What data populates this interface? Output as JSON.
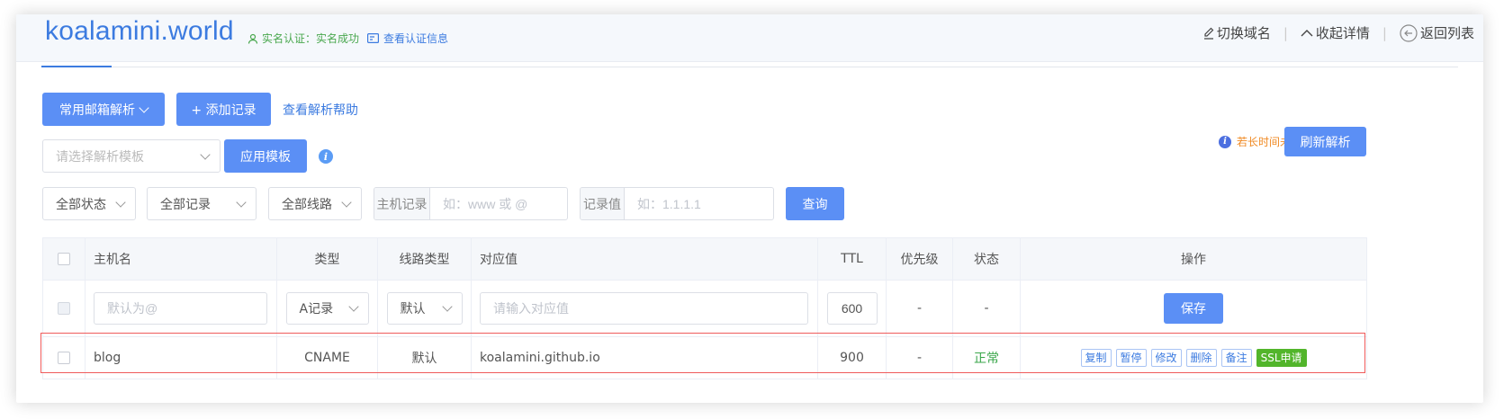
{
  "header": {
    "domain": "koalamini.world",
    "verify_text": "实名认证：实名成功",
    "view_verify": "查看认证信息",
    "switch_domain": "切换域名",
    "collapse": "收起详情",
    "back": "返回列表"
  },
  "toolbar": {
    "mail_parse": "常用邮箱解析",
    "add_record": "+ 添加记录",
    "help": "查看解析帮助",
    "template_placeholder": "请选择解析模板",
    "apply_template": "应用模板",
    "notice": "若长时间未生效，请点击：",
    "refresh": "刷新解析"
  },
  "filters": {
    "status": "全部状态",
    "record": "全部记录",
    "line": "全部线路",
    "host_label": "主机记录",
    "host_placeholder": "如：www 或 @",
    "value_label": "记录值",
    "value_placeholder": "如：1.1.1.1",
    "query": "查询"
  },
  "table": {
    "headers": [
      "主机名",
      "类型",
      "线路类型",
      "对应值",
      "TTL",
      "优先级",
      "状态",
      "操作"
    ],
    "new_row": {
      "host_placeholder": "默认为@",
      "type": "A记录",
      "line": "默认",
      "value_placeholder": "请输入对应值",
      "ttl": "600",
      "priority": "-",
      "status": "-",
      "save": "保存"
    },
    "rows": [
      {
        "host": "blog",
        "type": "CNAME",
        "line": "默认",
        "value": "koalamini.github.io",
        "ttl": "900",
        "priority": "-",
        "status": "正常",
        "ops": [
          "复制",
          "暂停",
          "修改",
          "删除",
          "备注",
          "SSL申请"
        ]
      }
    ]
  },
  "colors": {
    "primary": "#5b8ff5",
    "link": "#3c7be0",
    "success": "#3aa64a",
    "warning": "#f08a24",
    "highlight": "#ef5b5b"
  }
}
